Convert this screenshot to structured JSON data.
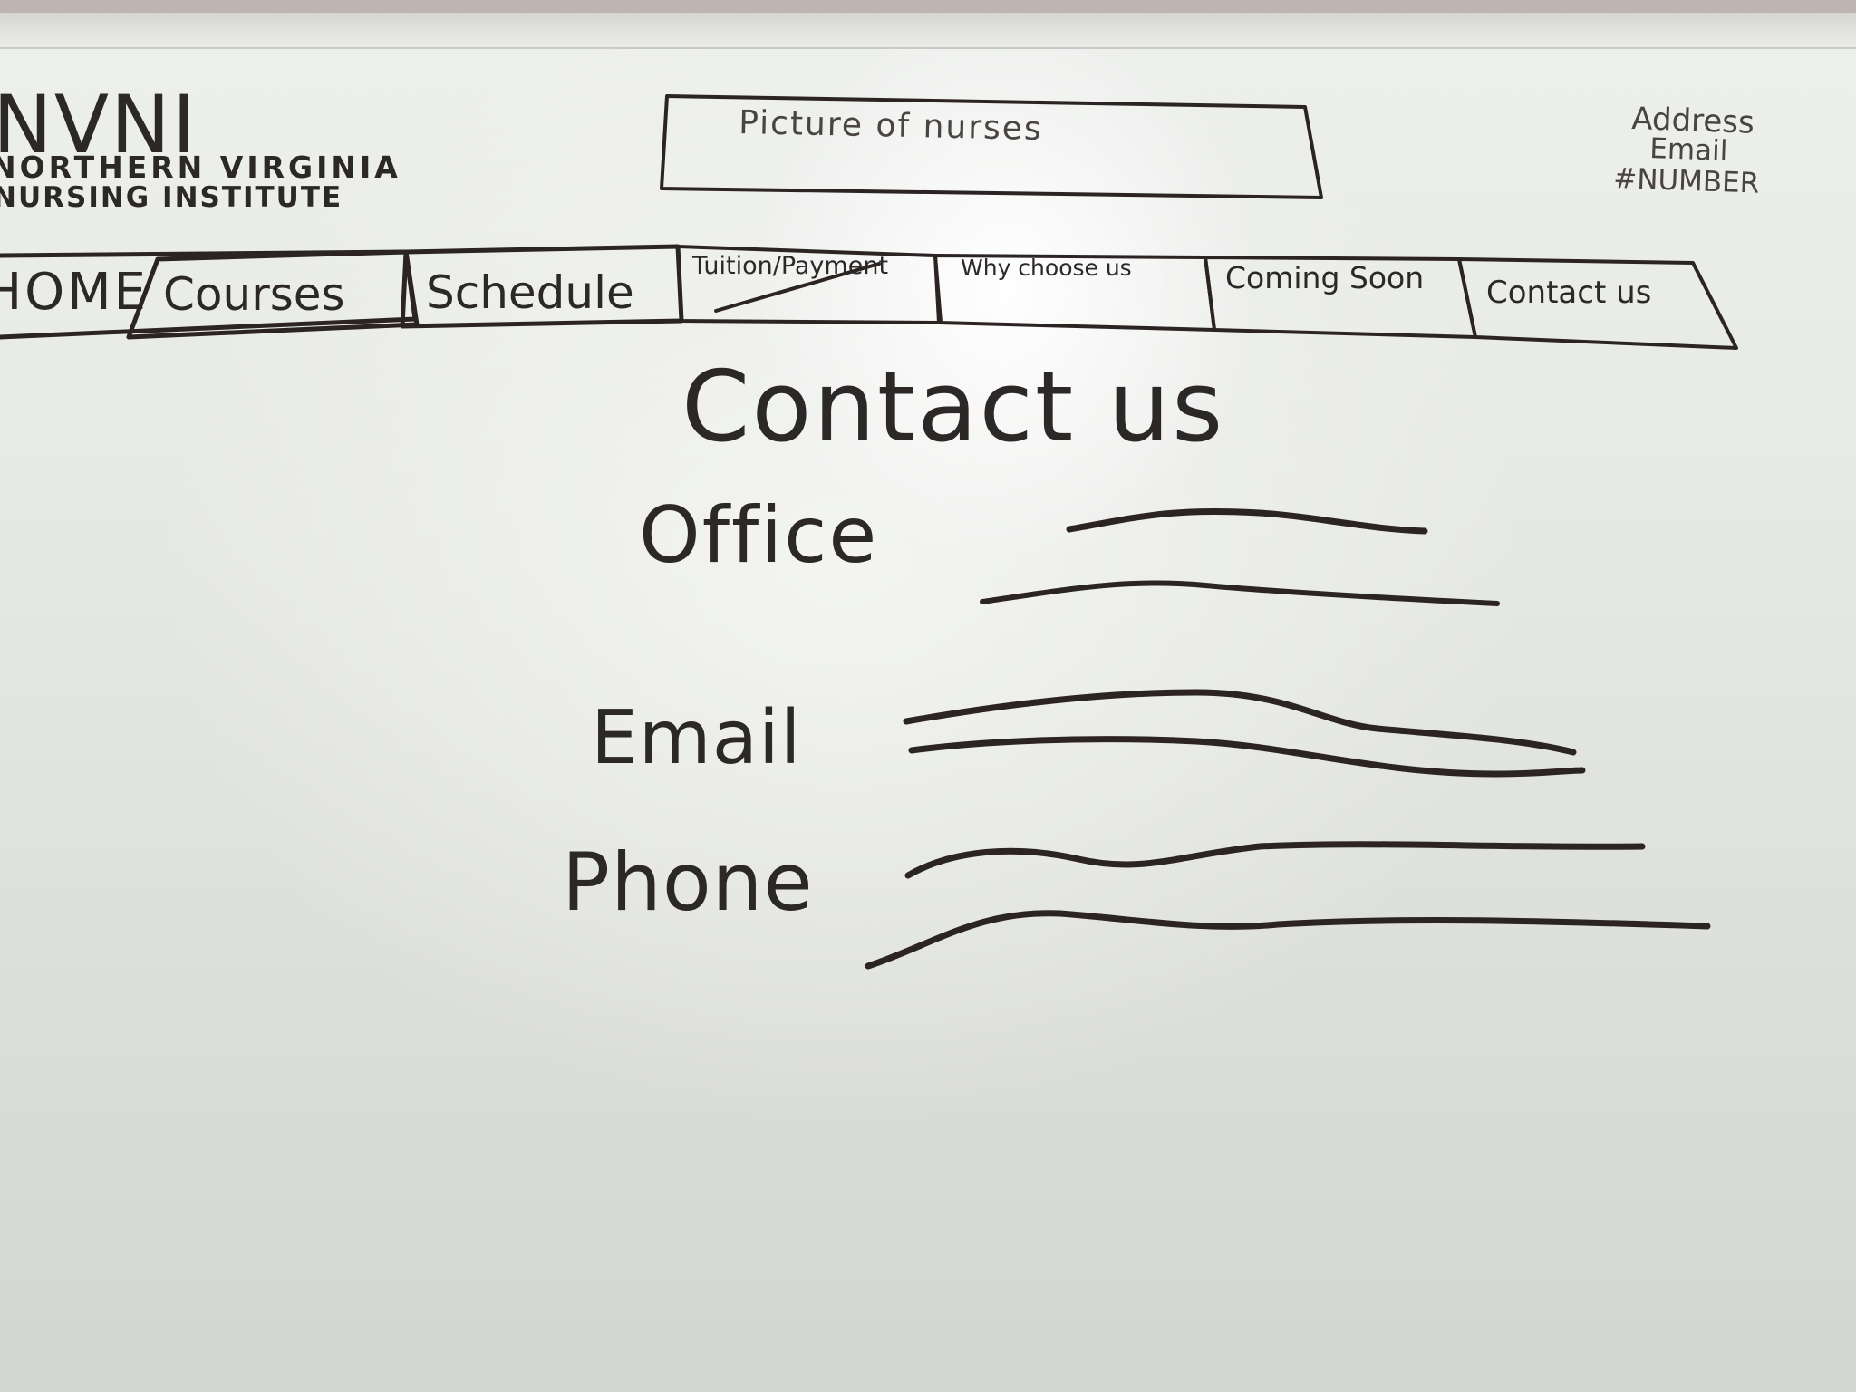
{
  "header": {
    "logo": "NVNI",
    "logo_subtitle_line1": "NORTHERN VIRGINIA",
    "logo_subtitle_line2": "NURSING INSTITUTE",
    "hero_placeholder": "Picture of nurses",
    "info_lines": [
      "Address",
      "Email",
      "#NUMBER"
    ]
  },
  "nav": {
    "items": [
      {
        "label": "HOME",
        "active": false
      },
      {
        "label": "Courses",
        "active": false
      },
      {
        "label": "Schedule",
        "active": false
      },
      {
        "label": "Tuition/Payment",
        "active": false
      },
      {
        "label": "Why choose us",
        "active": false
      },
      {
        "label": "Coming Soon",
        "active": false
      },
      {
        "label": "Contact us",
        "active": true
      }
    ]
  },
  "main": {
    "title": "Contact us",
    "fields": [
      {
        "label": "Office"
      },
      {
        "label": "Email"
      },
      {
        "label": "Phone"
      }
    ]
  },
  "colors": {
    "ink": "#2b2422",
    "board": "#eceeec"
  }
}
